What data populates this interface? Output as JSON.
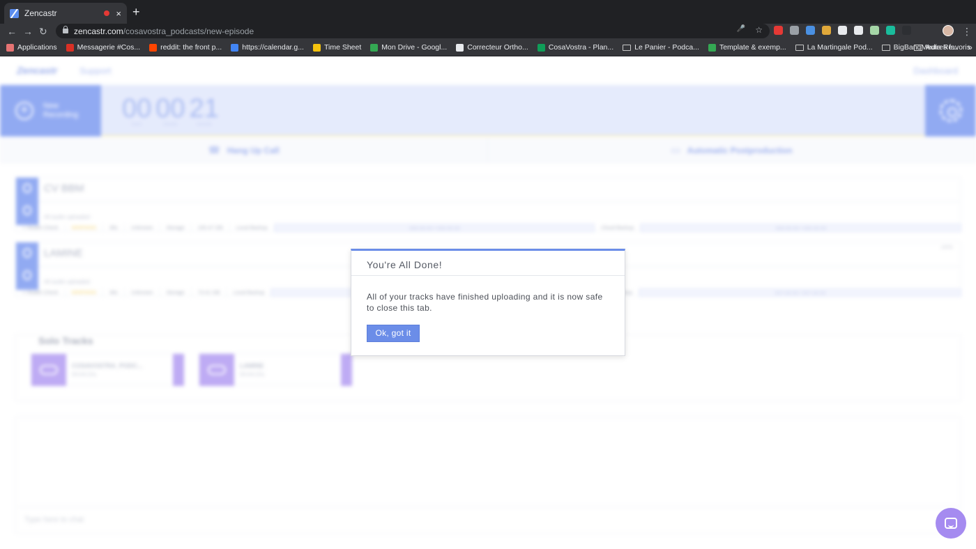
{
  "browser": {
    "tab_title": "Zencastr",
    "close_glyph": "×",
    "new_tab_glyph": "+",
    "url_host": "zencastr.com",
    "url_path": "/cosavostra_podcasts/new-episode",
    "nav": {
      "back": "←",
      "forward": "→",
      "reload": "↻"
    },
    "omni_icons": {
      "mic": "🎤",
      "star": "☆"
    },
    "menu": "⋮",
    "ext_colors": [
      "#e53935",
      "#9aa0a6",
      "#4a90e2",
      "#e0a83a",
      "#e8eaed",
      "#e8eaed",
      "#a5d6a7",
      "#1abc9c",
      "#2d2f33"
    ],
    "bookmarks": [
      {
        "label": "Applications",
        "icon_color": "#e57373"
      },
      {
        "label": "Messagerie #Cos...",
        "icon_color": "#d93025"
      },
      {
        "label": "reddit: the front p...",
        "icon_color": "#ff4500"
      },
      {
        "label": "https://calendar.g...",
        "icon_color": "#4285f4"
      },
      {
        "label": "Time Sheet",
        "icon_color": "#f4c20d"
      },
      {
        "label": "Mon Drive - Googl...",
        "icon_color": "#34a853"
      },
      {
        "label": "Correcteur Ortho...",
        "icon_color": "#e8eaed"
      },
      {
        "label": "CosaVostra - Plan...",
        "icon_color": "#0f9d58"
      },
      {
        "label": "Le Panier - Podca...",
        "icon_color": "folder"
      },
      {
        "label": "Template & exemp...",
        "icon_color": "#34a853"
      },
      {
        "label": "La Martingale Pod...",
        "icon_color": "folder"
      },
      {
        "label": "BigBangMedia Re...",
        "icon_color": "folder"
      }
    ],
    "bookmarks_more": "»",
    "other_bookmarks": "Autres favoris"
  },
  "app": {
    "logo": "Zencastr",
    "support": "Support",
    "dashboard": "Dashboard",
    "new_recording": "New Recording",
    "timer": [
      {
        "value": "00",
        "unit": "hours"
      },
      {
        "value": "00",
        "unit": "minutes"
      },
      {
        "value": "21",
        "unit": "seconds"
      }
    ],
    "hang_up": "Hang Up Call",
    "postproduction": "Automatic Postproduction",
    "guests": [
      {
        "name": "CV BBM",
        "uploaded": "All audio uploaded",
        "health": "+ Health Check",
        "status": "WARNING",
        "mic_label": "Mic",
        "mic": "Unknown",
        "storage_label": "Storage",
        "storage": "100.47 GB",
        "local_label": "Local Backup",
        "local": "000:00:00 / 000:00:00",
        "cloud_label": "Cloud Backup",
        "cloud": "000:00:00 / 000:00:00",
        "pct": ""
      },
      {
        "name": "LAMINE",
        "uploaded": "All audio uploaded",
        "health": "+ Health Check",
        "status": "WARNING",
        "mic_label": "Mic",
        "mic": "Unknown",
        "storage_label": "Storage",
        "storage": "73.41 GB",
        "local_label": "Local Backup",
        "local": "",
        "cloud_label": "Cloud Backup",
        "cloud": "007:40:00 / 007:40:00",
        "pct": "100%"
      }
    ],
    "solo_title": "Solo Tracks",
    "solo_tracks": [
      {
        "name": "COSAVOSTRA_PODC...",
        "duration": "00:04:22s"
      },
      {
        "name": "LAMINE",
        "duration": "00:04:22s"
      }
    ],
    "chat_placeholder": "Type here to chat"
  },
  "modal": {
    "title": "You're All Done!",
    "message": "All of your tracks have finished uploading and it is now safe to close this tab.",
    "ok_label": "Ok, got it"
  },
  "colors": {
    "accent": "#6b8de8",
    "solo": "#a98ff0"
  }
}
